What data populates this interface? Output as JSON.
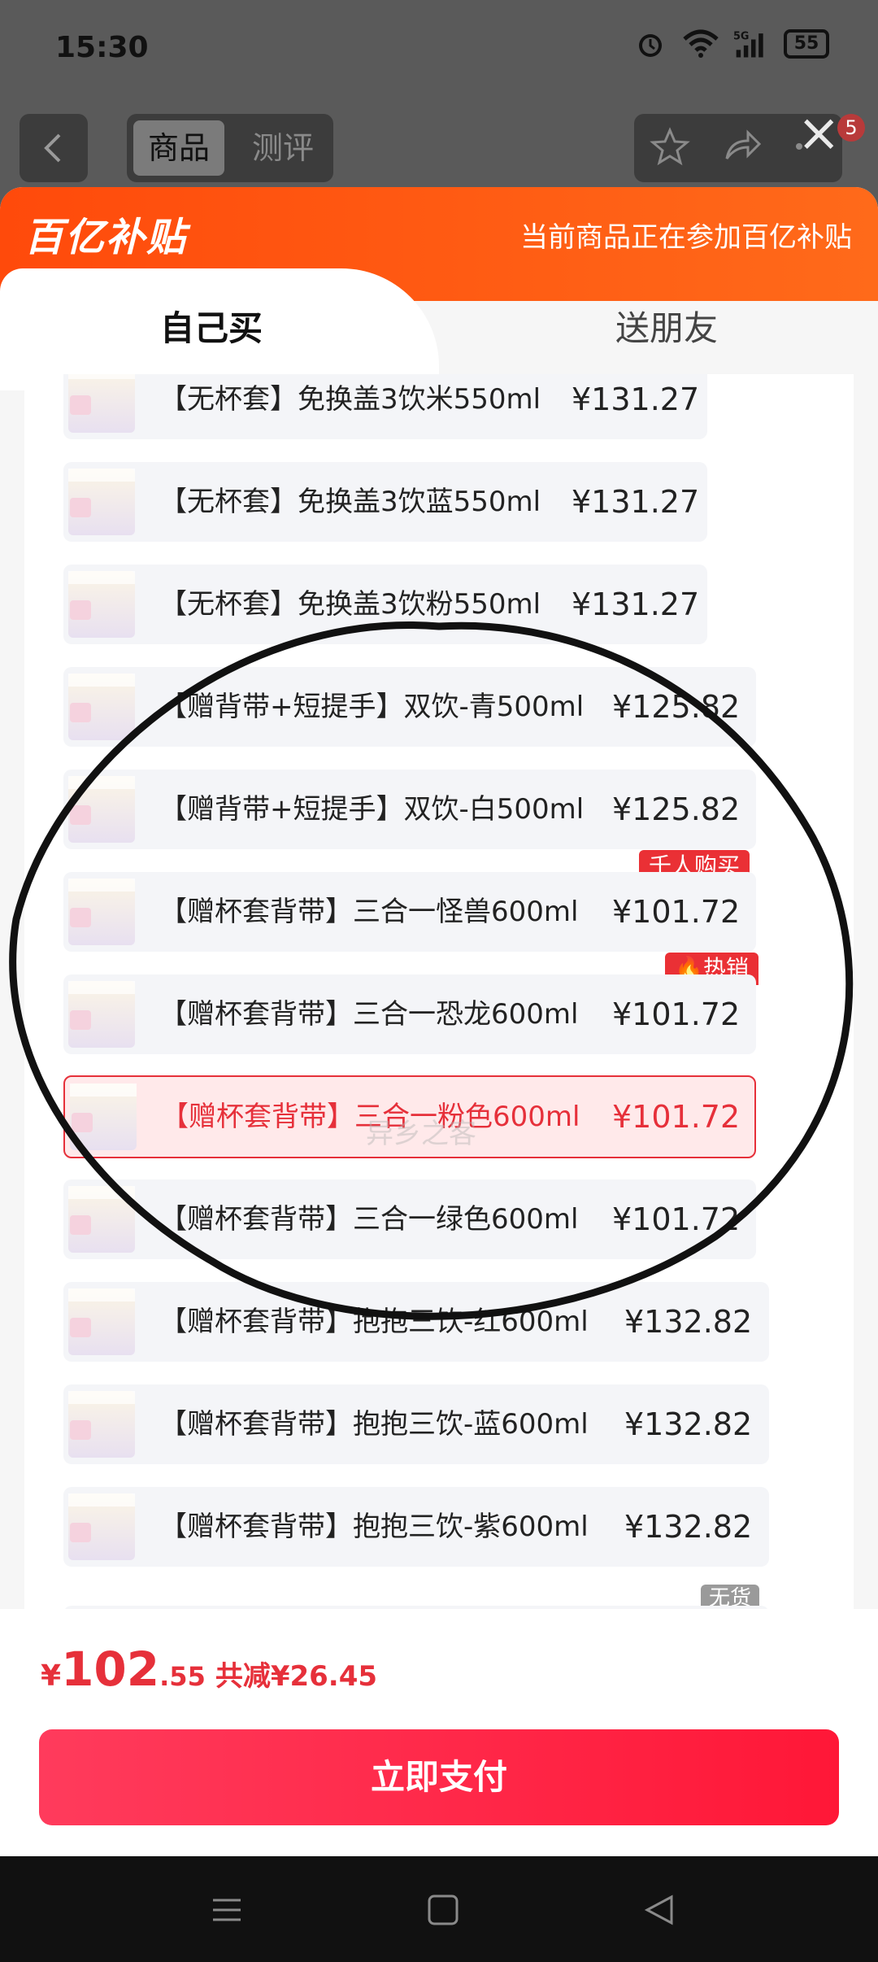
{
  "status_bar": {
    "time": "15:30",
    "battery": "55"
  },
  "top_bar": {
    "tab_product": "商品",
    "tab_review": "测评",
    "cart_count": "5"
  },
  "sheet": {
    "logo": "百亿补贴",
    "promo_note": "当前商品正在参加百亿补贴",
    "tab_self": "自己买",
    "tab_friend": "送朋友"
  },
  "items": [
    {
      "label": "【无杯套】免换盖3饮米550ml",
      "price": "¥131.27"
    },
    {
      "label": "【无杯套】免换盖3饮蓝550ml",
      "price": "¥131.27"
    },
    {
      "label": "【无杯套】免换盖3饮粉550ml",
      "price": "¥131.27"
    },
    {
      "label": "【赠背带+短提手】双饮-青500ml",
      "price": "¥125.82"
    },
    {
      "label": "【赠背带+短提手】双饮-白500ml",
      "price": "¥125.82"
    },
    {
      "label": "【赠杯套背带】三合一怪兽600ml",
      "price": "¥101.72",
      "tag": "千人购买"
    },
    {
      "label": "【赠杯套背带】三合一恐龙600ml",
      "price": "¥101.72",
      "tag": "🔥热销"
    },
    {
      "label": "【赠杯套背带】三合一粉色600ml",
      "price": "¥101.72",
      "selected": true
    },
    {
      "label": "【赠杯套背带】三合一绿色600ml",
      "price": "¥101.72"
    },
    {
      "label": "【赠杯套背带】抱抱三饮-红600ml",
      "price": "¥132.82"
    },
    {
      "label": "【赠杯套背带】抱抱三饮-蓝600ml",
      "price": "¥132.82"
    },
    {
      "label": "【赠杯套背带】抱抱三饮-紫600ml",
      "price": "¥132.82"
    }
  ],
  "out_of_stock_tag": "无货",
  "watermark": "异乡之客",
  "footer": {
    "yen": "¥",
    "price_int": "102",
    "price_dec": ".55",
    "saving": "共减¥26.45",
    "pay_label": "立即支付"
  }
}
